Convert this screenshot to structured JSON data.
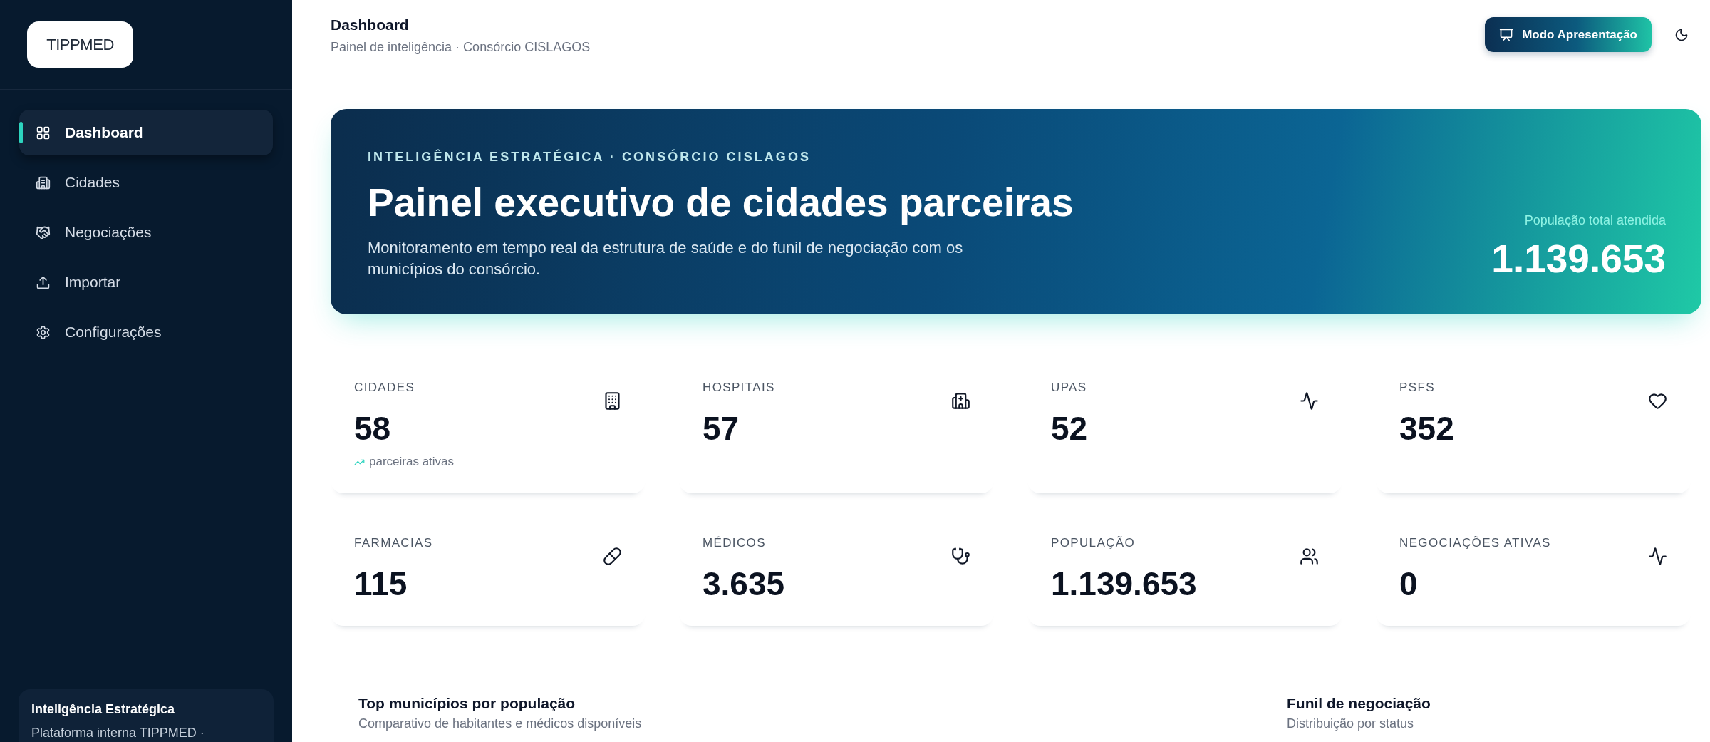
{
  "sidebar": {
    "logo": "TIPPMED",
    "items": [
      {
        "label": "Dashboard",
        "selected": true
      },
      {
        "label": "Cidades",
        "selected": false
      },
      {
        "label": "Negociações",
        "selected": false
      },
      {
        "label": "Importar",
        "selected": false
      },
      {
        "label": "Configurações",
        "selected": false
      }
    ],
    "footer": {
      "title": "Inteligência Estratégica",
      "text": "Plataforma interna TIPPMED ·"
    }
  },
  "header": {
    "title": "Dashboard",
    "subtitle": "Painel de inteligência · Consórcio CISLAGOS",
    "present_button": "Modo Apresentação"
  },
  "hero": {
    "eyebrow": "INTELIGÊNCIA ESTRATÉGICA · CONSÓRCIO CISLAGOS",
    "title": "Painel executivo de cidades parceiras",
    "description": "Monitoramento em tempo real da estrutura de saúde e do funil de negociação com os municípios do consórcio.",
    "total_label": "População total atendida",
    "total_value": "1.139.653"
  },
  "stats": [
    {
      "label": "CIDADES",
      "value": "58",
      "note": "parceiras ativas"
    },
    {
      "label": "HOSPITAIS",
      "value": "57"
    },
    {
      "label": "UPAS",
      "value": "52"
    },
    {
      "label": "PSFS",
      "value": "352"
    },
    {
      "label": "FARMACIAS",
      "value": "115"
    },
    {
      "label": "MÉDICOS",
      "value": "3.635"
    },
    {
      "label": "POPULAÇÃO",
      "value": "1.139.653"
    },
    {
      "label": "NEGOCIAÇÕES ATIVAS",
      "value": "0"
    }
  ],
  "sections": [
    {
      "title": "Top municípios por população",
      "subtitle": "Comparativo de habitantes e médicos disponíveis"
    },
    {
      "title": "Funil de negociação",
      "subtitle": "Distribuição por status"
    }
  ]
}
